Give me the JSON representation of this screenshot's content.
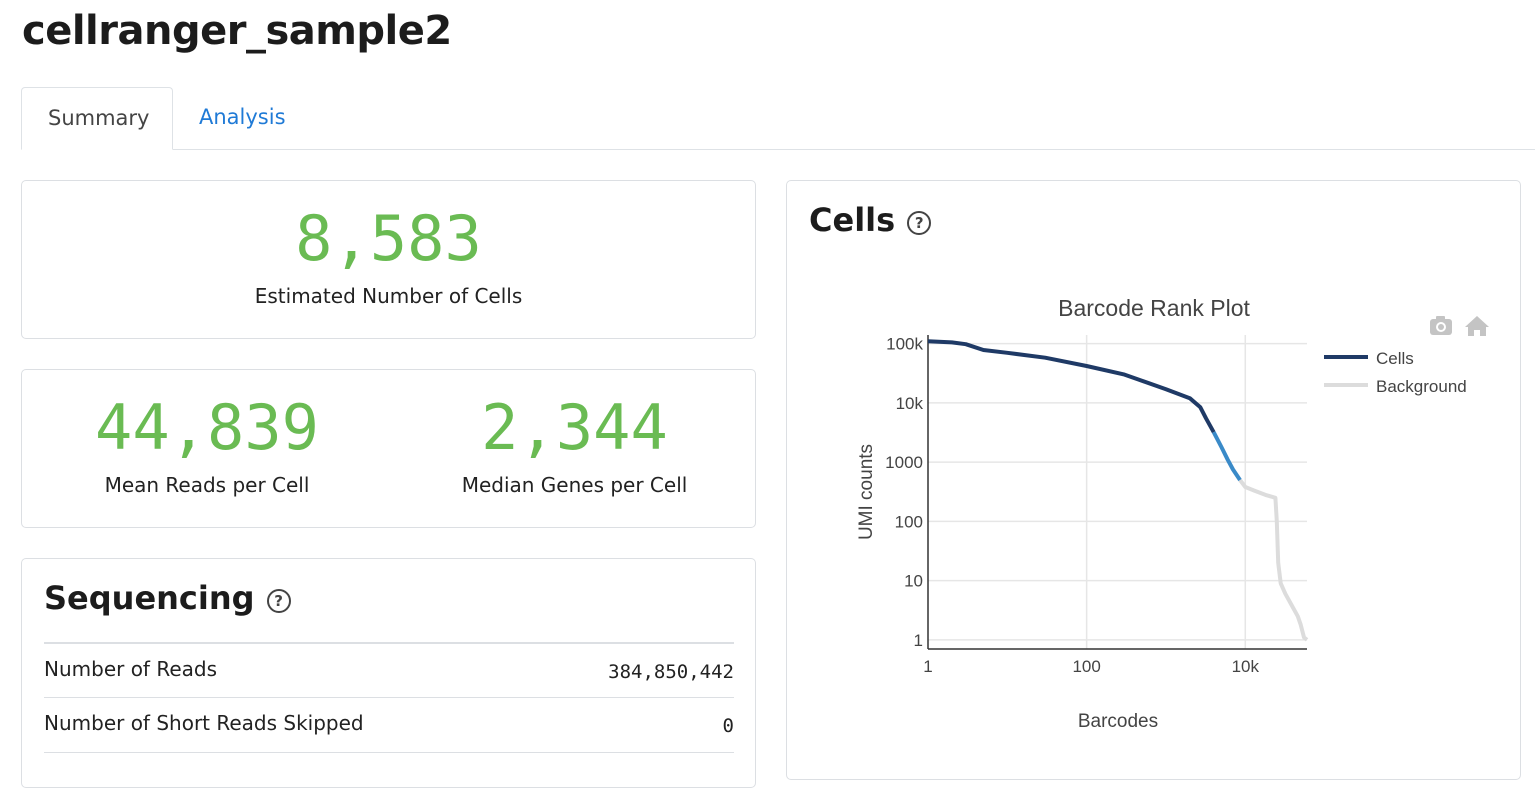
{
  "page": {
    "title": "cellranger_sample2"
  },
  "tabs": [
    {
      "label": "Summary",
      "active": true
    },
    {
      "label": "Analysis",
      "active": false
    }
  ],
  "metrics": {
    "cells": {
      "value": "8,583",
      "label": "Estimated Number of Cells"
    },
    "reads": {
      "value": "44,839",
      "label": "Mean Reads per Cell"
    },
    "genes": {
      "value": "2,344",
      "label": "Median Genes per Cell"
    }
  },
  "sequencing": {
    "title": "Sequencing",
    "help_glyph": "?",
    "rows": [
      {
        "label": "Number of Reads",
        "value": "384,850,442"
      },
      {
        "label": "Number of Short Reads Skipped",
        "value": "0"
      }
    ]
  },
  "cells_panel": {
    "title": "Cells",
    "help_glyph": "?",
    "toolbar_icons": [
      "camera-icon",
      "home-icon"
    ]
  },
  "colors": {
    "metric_green": "#6abb53",
    "cells_line": "#1f3a66",
    "cells_line_tail": "#3a8ac8",
    "background_line": "#dcdcdc",
    "link_blue": "#1f7ad6"
  },
  "chart_data": {
    "type": "line",
    "title": "Barcode Rank Plot",
    "xlabel": "Barcodes",
    "ylabel": "UMI counts",
    "x_scale": "log",
    "y_scale": "log",
    "xlim": [
      1,
      60000
    ],
    "ylim": [
      0.7,
      140000
    ],
    "x_ticks": [
      "1",
      "100",
      "10k"
    ],
    "y_ticks": [
      "100k",
      "10k",
      "1000",
      "100",
      "10",
      "1"
    ],
    "grid": true,
    "legend": "top-right",
    "series": [
      {
        "name": "Cells",
        "x": [
          1,
          2,
          3,
          5,
          10,
          30,
          100,
          300,
          1000,
          2000,
          2700,
          3200,
          4000,
          5000,
          6000,
          7000,
          8583
        ],
        "y": [
          110000,
          105000,
          98000,
          78000,
          70000,
          58000,
          42000,
          30000,
          17000,
          12000,
          8500,
          5500,
          3200,
          1800,
          1100,
          750,
          500
        ]
      },
      {
        "name": "Background",
        "x": [
          8583,
          10000,
          13000,
          18000,
          24000,
          25000,
          26000,
          28000,
          32000,
          40000,
          46000,
          50000,
          55000,
          60000
        ],
        "y": [
          500,
          380,
          330,
          280,
          250,
          100,
          20,
          9,
          6,
          3.5,
          2.5,
          1.8,
          1.1,
          1
        ]
      }
    ]
  }
}
